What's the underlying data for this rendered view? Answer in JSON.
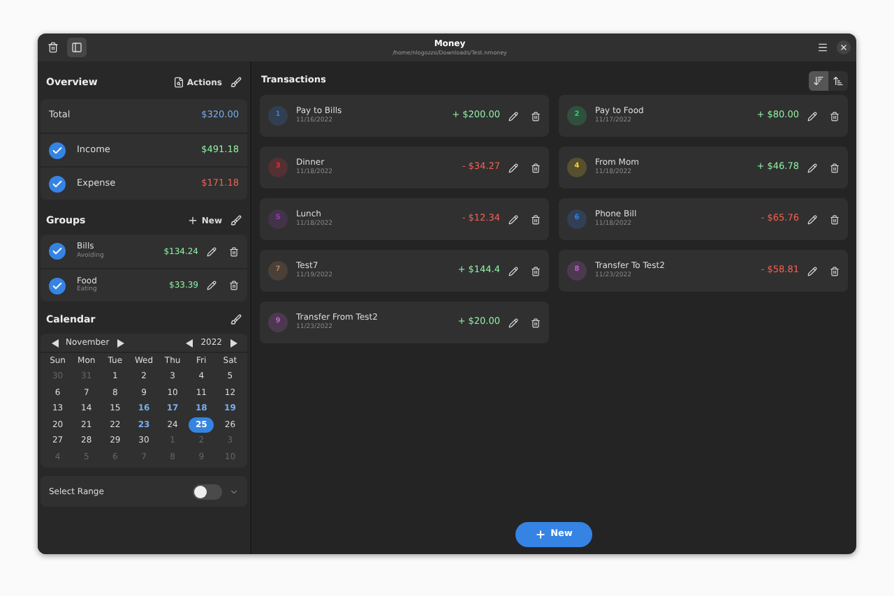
{
  "window": {
    "title": "Money",
    "subtitle": "/home/nlogozzo/Downloads/Test.nmoney"
  },
  "overview": {
    "title": "Overview",
    "actions_label": "Actions",
    "rows": [
      {
        "kind": "total",
        "label": "Total",
        "value": "$320.00"
      },
      {
        "kind": "income",
        "label": "Income",
        "value": "$491.18",
        "checked": true
      },
      {
        "kind": "expense",
        "label": "Expense",
        "value": "$171.18",
        "checked": true
      }
    ]
  },
  "groups": {
    "title": "Groups",
    "new_label": "New",
    "items": [
      {
        "name": "Bills",
        "description": "Avoiding",
        "amount": "$134.24",
        "checked": true
      },
      {
        "name": "Food",
        "description": "Eating",
        "amount": "$33.39",
        "checked": true
      }
    ]
  },
  "calendar": {
    "title": "Calendar",
    "month": "November",
    "year": "2022",
    "weekdays": [
      "Sun",
      "Mon",
      "Tue",
      "Wed",
      "Thu",
      "Fri",
      "Sat"
    ],
    "weeks": [
      [
        {
          "day": "30",
          "kind": "other"
        },
        {
          "day": "31",
          "kind": "other"
        },
        {
          "day": "1",
          "kind": "normal"
        },
        {
          "day": "2",
          "kind": "normal"
        },
        {
          "day": "3",
          "kind": "normal"
        },
        {
          "day": "4",
          "kind": "normal"
        },
        {
          "day": "5",
          "kind": "normal"
        }
      ],
      [
        {
          "day": "6",
          "kind": "normal"
        },
        {
          "day": "7",
          "kind": "normal"
        },
        {
          "day": "8",
          "kind": "normal"
        },
        {
          "day": "9",
          "kind": "normal"
        },
        {
          "day": "10",
          "kind": "normal"
        },
        {
          "day": "11",
          "kind": "normal"
        },
        {
          "day": "12",
          "kind": "normal"
        }
      ],
      [
        {
          "day": "13",
          "kind": "normal"
        },
        {
          "day": "14",
          "kind": "normal"
        },
        {
          "day": "15",
          "kind": "normal"
        },
        {
          "day": "16",
          "kind": "marked"
        },
        {
          "day": "17",
          "kind": "marked"
        },
        {
          "day": "18",
          "kind": "marked"
        },
        {
          "day": "19",
          "kind": "marked"
        }
      ],
      [
        {
          "day": "20",
          "kind": "normal"
        },
        {
          "day": "21",
          "kind": "normal"
        },
        {
          "day": "22",
          "kind": "normal"
        },
        {
          "day": "23",
          "kind": "marked"
        },
        {
          "day": "24",
          "kind": "normal"
        },
        {
          "day": "25",
          "kind": "selected"
        },
        {
          "day": "26",
          "kind": "normal"
        }
      ],
      [
        {
          "day": "27",
          "kind": "normal"
        },
        {
          "day": "28",
          "kind": "normal"
        },
        {
          "day": "29",
          "kind": "normal"
        },
        {
          "day": "30",
          "kind": "normal"
        },
        {
          "day": "1",
          "kind": "other"
        },
        {
          "day": "2",
          "kind": "other"
        },
        {
          "day": "3",
          "kind": "other"
        }
      ],
      [
        {
          "day": "4",
          "kind": "other"
        },
        {
          "day": "5",
          "kind": "other"
        },
        {
          "day": "6",
          "kind": "other"
        },
        {
          "day": "7",
          "kind": "other"
        },
        {
          "day": "8",
          "kind": "other"
        },
        {
          "day": "9",
          "kind": "other"
        },
        {
          "day": "10",
          "kind": "other"
        }
      ]
    ],
    "range_label": "Select Range",
    "range_on": false
  },
  "transactions": {
    "title": "Transactions",
    "sort": [
      {
        "kind": "descending",
        "selected": true
      },
      {
        "kind": "ascending",
        "selected": false
      }
    ],
    "columns": [
      [
        {
          "id": "1",
          "name": "Pay to Bills",
          "date": "11/16/2022",
          "amount": "+ $200.00",
          "kind": "income",
          "color": "#3a7bd5"
        },
        {
          "id": "3",
          "name": "Dinner",
          "date": "11/18/2022",
          "amount": "- $34.27",
          "kind": "expense",
          "color": "#e0303a"
        },
        {
          "id": "5",
          "name": "Lunch",
          "date": "11/18/2022",
          "amount": "- $12.34",
          "kind": "expense",
          "color": "#9141ac"
        },
        {
          "id": "7",
          "name": "Test7",
          "date": "11/19/2022",
          "amount": "+ $144.4",
          "kind": "income",
          "color": "#b5835a"
        },
        {
          "id": "9",
          "name": "Transfer From Test2",
          "date": "11/23/2022",
          "amount": "+ $20.00",
          "kind": "income",
          "color": "#c061cb"
        }
      ],
      [
        {
          "id": "2",
          "name": "Pay to Food",
          "date": "11/17/2022",
          "amount": "+ $80.00",
          "kind": "income",
          "color": "#33d17a"
        },
        {
          "id": "4",
          "name": "From Mom",
          "date": "11/18/2022",
          "amount": "+ $46.78",
          "kind": "income",
          "color": "#f6d32d"
        },
        {
          "id": "6",
          "name": "Phone Bill",
          "date": "11/18/2022",
          "amount": "- $65.76",
          "kind": "expense",
          "color": "#3584e4"
        },
        {
          "id": "8",
          "name": "Transfer To Test2",
          "date": "11/23/2022",
          "amount": "- $58.81",
          "kind": "expense",
          "color": "#c061cb"
        }
      ]
    ],
    "new_label": "New"
  }
}
